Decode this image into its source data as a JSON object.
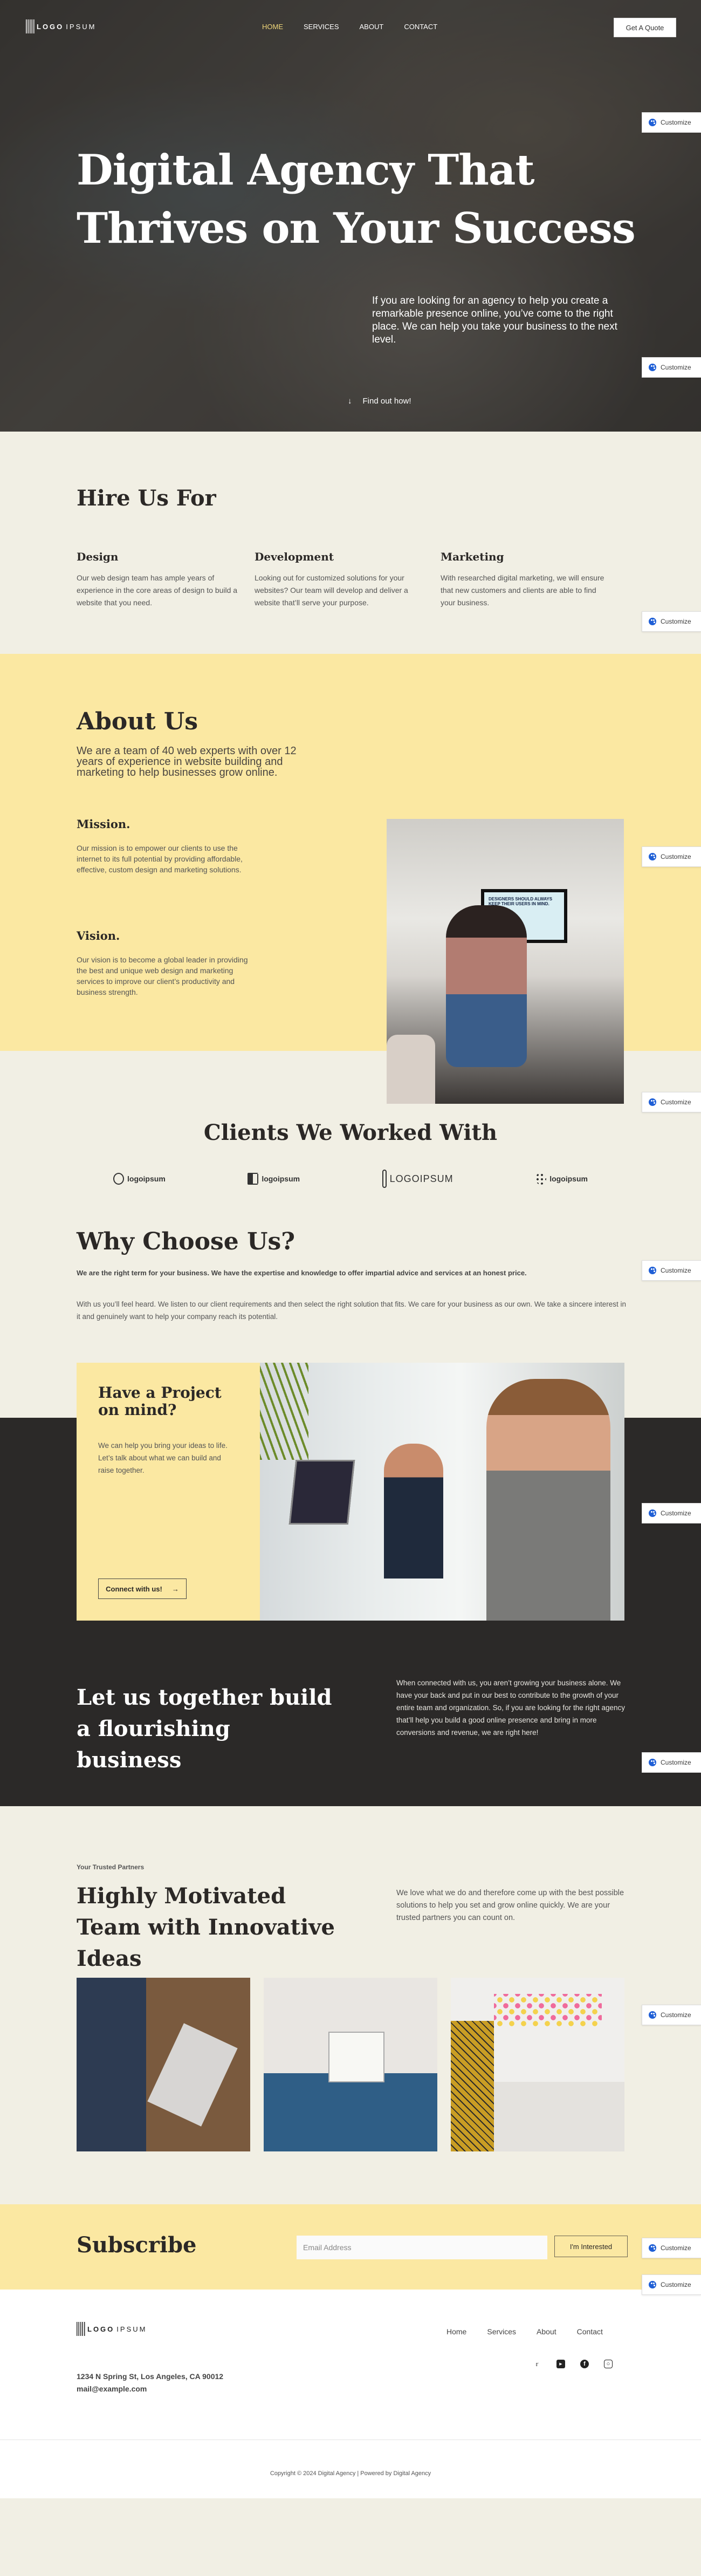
{
  "brand": {
    "logo_bold": "LOGO",
    "logo_light": "IPSUM"
  },
  "nav": {
    "items": [
      {
        "label": "HOME",
        "active": true
      },
      {
        "label": "SERVICES",
        "active": false
      },
      {
        "label": "ABOUT",
        "active": false
      },
      {
        "label": "CONTACT",
        "active": false
      }
    ],
    "cta": "Get A Quote"
  },
  "customize_label": "Customize",
  "hero": {
    "title_line1": "Digital Agency That",
    "title_line2": "Thrives on Your Success",
    "text": "If you are looking for an agency to help you create a remarkable presence online, you’ve come to the right place. We can help you take your business to the next level.",
    "scroll_label": "Find out how!"
  },
  "hire": {
    "title": "Hire Us For",
    "services": [
      {
        "title": "Design",
        "text": "Our web design team has ample years of experience in the core areas of design to build a website that you need."
      },
      {
        "title": "Development",
        "text": "Looking out for customized solutions for your websites? Our team will develop and deliver a website that’ll serve your purpose."
      },
      {
        "title": "Marketing",
        "text": "With researched digital marketing, we will ensure that new customers and clients are able to find your business."
      }
    ]
  },
  "about": {
    "title": "About Us",
    "lead": "We are a team of 40 web experts with over 12 years of experience in website building and marketing to help businesses grow online.",
    "mission_title": "Mission.",
    "mission_text": "Our mission is to empower our clients to use the internet to its full potential by providing affordable, effective, custom design and marketing solutions.",
    "vision_title": "Vision.",
    "vision_text": "Our vision is to become a global leader in providing the best and unique web design and marketing services to improve our client’s productivity and business strength.",
    "image_caption": "DESIGNERS SHOULD ALWAYS KEEP THEIR USERS IN MIND."
  },
  "clients": {
    "title": "Clients We Worked With",
    "logos": [
      "logoipsum",
      "logoipsum",
      "LOGOIPSUM",
      "logoipsum"
    ]
  },
  "why": {
    "title": "Why Choose Us?",
    "bold_text": "We are the right term for your business. We have the expertise and knowledge to offer impartial advice and services at an honest price.",
    "text": "With us you’ll feel heard. We listen to our client requirements and then select the right solution that fits. We care for your business as our own. We take a sincere interest in it and genuinely want to help your company reach its potential."
  },
  "project": {
    "title": "Have a Project on mind?",
    "text": "We can help you bring your ideas to life. Let’s talk about what we can build and raise together.",
    "button": "Connect with us!"
  },
  "together": {
    "title": "Let us together build a flourishing business",
    "text": "When connected with us, you aren’t growing your business alone. We have your back and put in our best to contribute to the growth of your entire team and organization. So, if you are looking for the right agency that’ll help you build a good online presence and bring in more conversions and revenue, we are right here!"
  },
  "team": {
    "eyebrow": "Your Trusted Partners",
    "title": "Highly Motivated Team with Innovative Ideas",
    "text": "We love what we do and therefore come up with the best possible solutions to help you set and grow online quickly. We are your trusted partners you can count on."
  },
  "subscribe": {
    "title": "Subscribe",
    "email_placeholder": "Email Address",
    "email_value": "",
    "button": "I'm Interested"
  },
  "footer": {
    "links": [
      "Home",
      "Services",
      "About",
      "Contact"
    ],
    "address": "1234 N Spring St, Los Angeles, CA 90012",
    "email": "mail@example.com",
    "socials": [
      "twitter-icon",
      "youtube-icon",
      "facebook-icon",
      "instagram-icon"
    ],
    "copyright": "Copyright © 2024 Digital Agency | Powered by Digital Agency"
  }
}
